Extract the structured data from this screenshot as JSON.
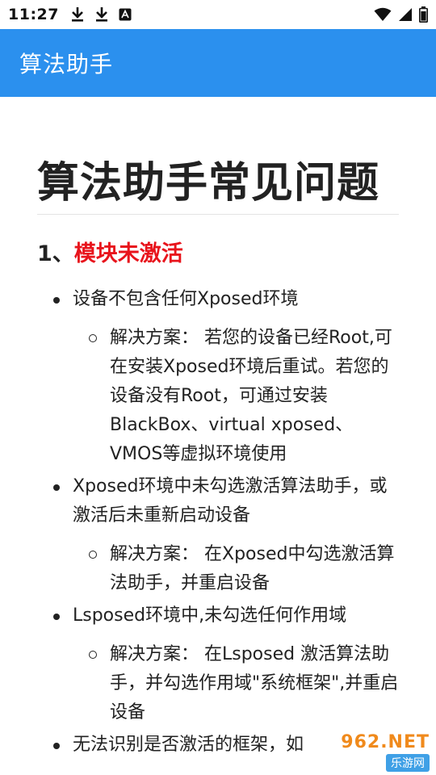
{
  "status_bar": {
    "time": "11:27",
    "left_icons": [
      "download-icon",
      "download-icon",
      "accessibility-icon"
    ],
    "right_icons": [
      "wifi-icon",
      "signal-icon",
      "battery-icon"
    ]
  },
  "app_bar": {
    "title": "算法助手",
    "color": "#2b90ee"
  },
  "article": {
    "heading": "算法助手常见问题",
    "section": {
      "number": "1、",
      "title": "模块未激活",
      "title_color": "#e8141c"
    },
    "items": [
      {
        "text": "设备不包含任何Xposed环境",
        "solution": "解决方案： 若您的设备已经Root,可在安装Xposed环境后重试。若您的设备没有Root，可通过安装BlackBox、virtual xposed、VMOS等虚拟环境使用"
      },
      {
        "text": "Xposed环境中未勾选激活算法助手，或激活后未重新启动设备",
        "solution": "解决方案： 在Xposed中勾选激活算法助手，并重启设备"
      },
      {
        "text": "Lsposed环境中,未勾选任何作用域",
        "solution": "解决方案： 在Lsposed 激活算法助手，并勾选作用域\"系统框架\",并重启设备"
      },
      {
        "text": "无法识别是否激活的框架，如",
        "solution": ""
      }
    ]
  },
  "watermark": {
    "top": "962.NET",
    "bottom": "乐游网"
  }
}
